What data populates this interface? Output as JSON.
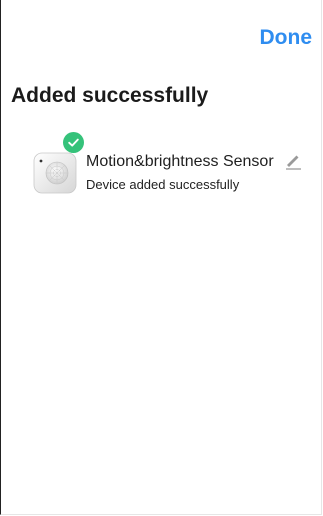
{
  "header": {
    "done_label": "Done"
  },
  "page": {
    "title": "Added successfully"
  },
  "device": {
    "name": "Motion&brightness Sensor",
    "status": "Device added successfully",
    "thumbnail_icon": "motion-sensor-image",
    "badge_icon": "check-circle-icon",
    "edit_icon": "pencil-icon"
  },
  "colors": {
    "accent": "#2f8df0",
    "success": "#35c27a"
  }
}
